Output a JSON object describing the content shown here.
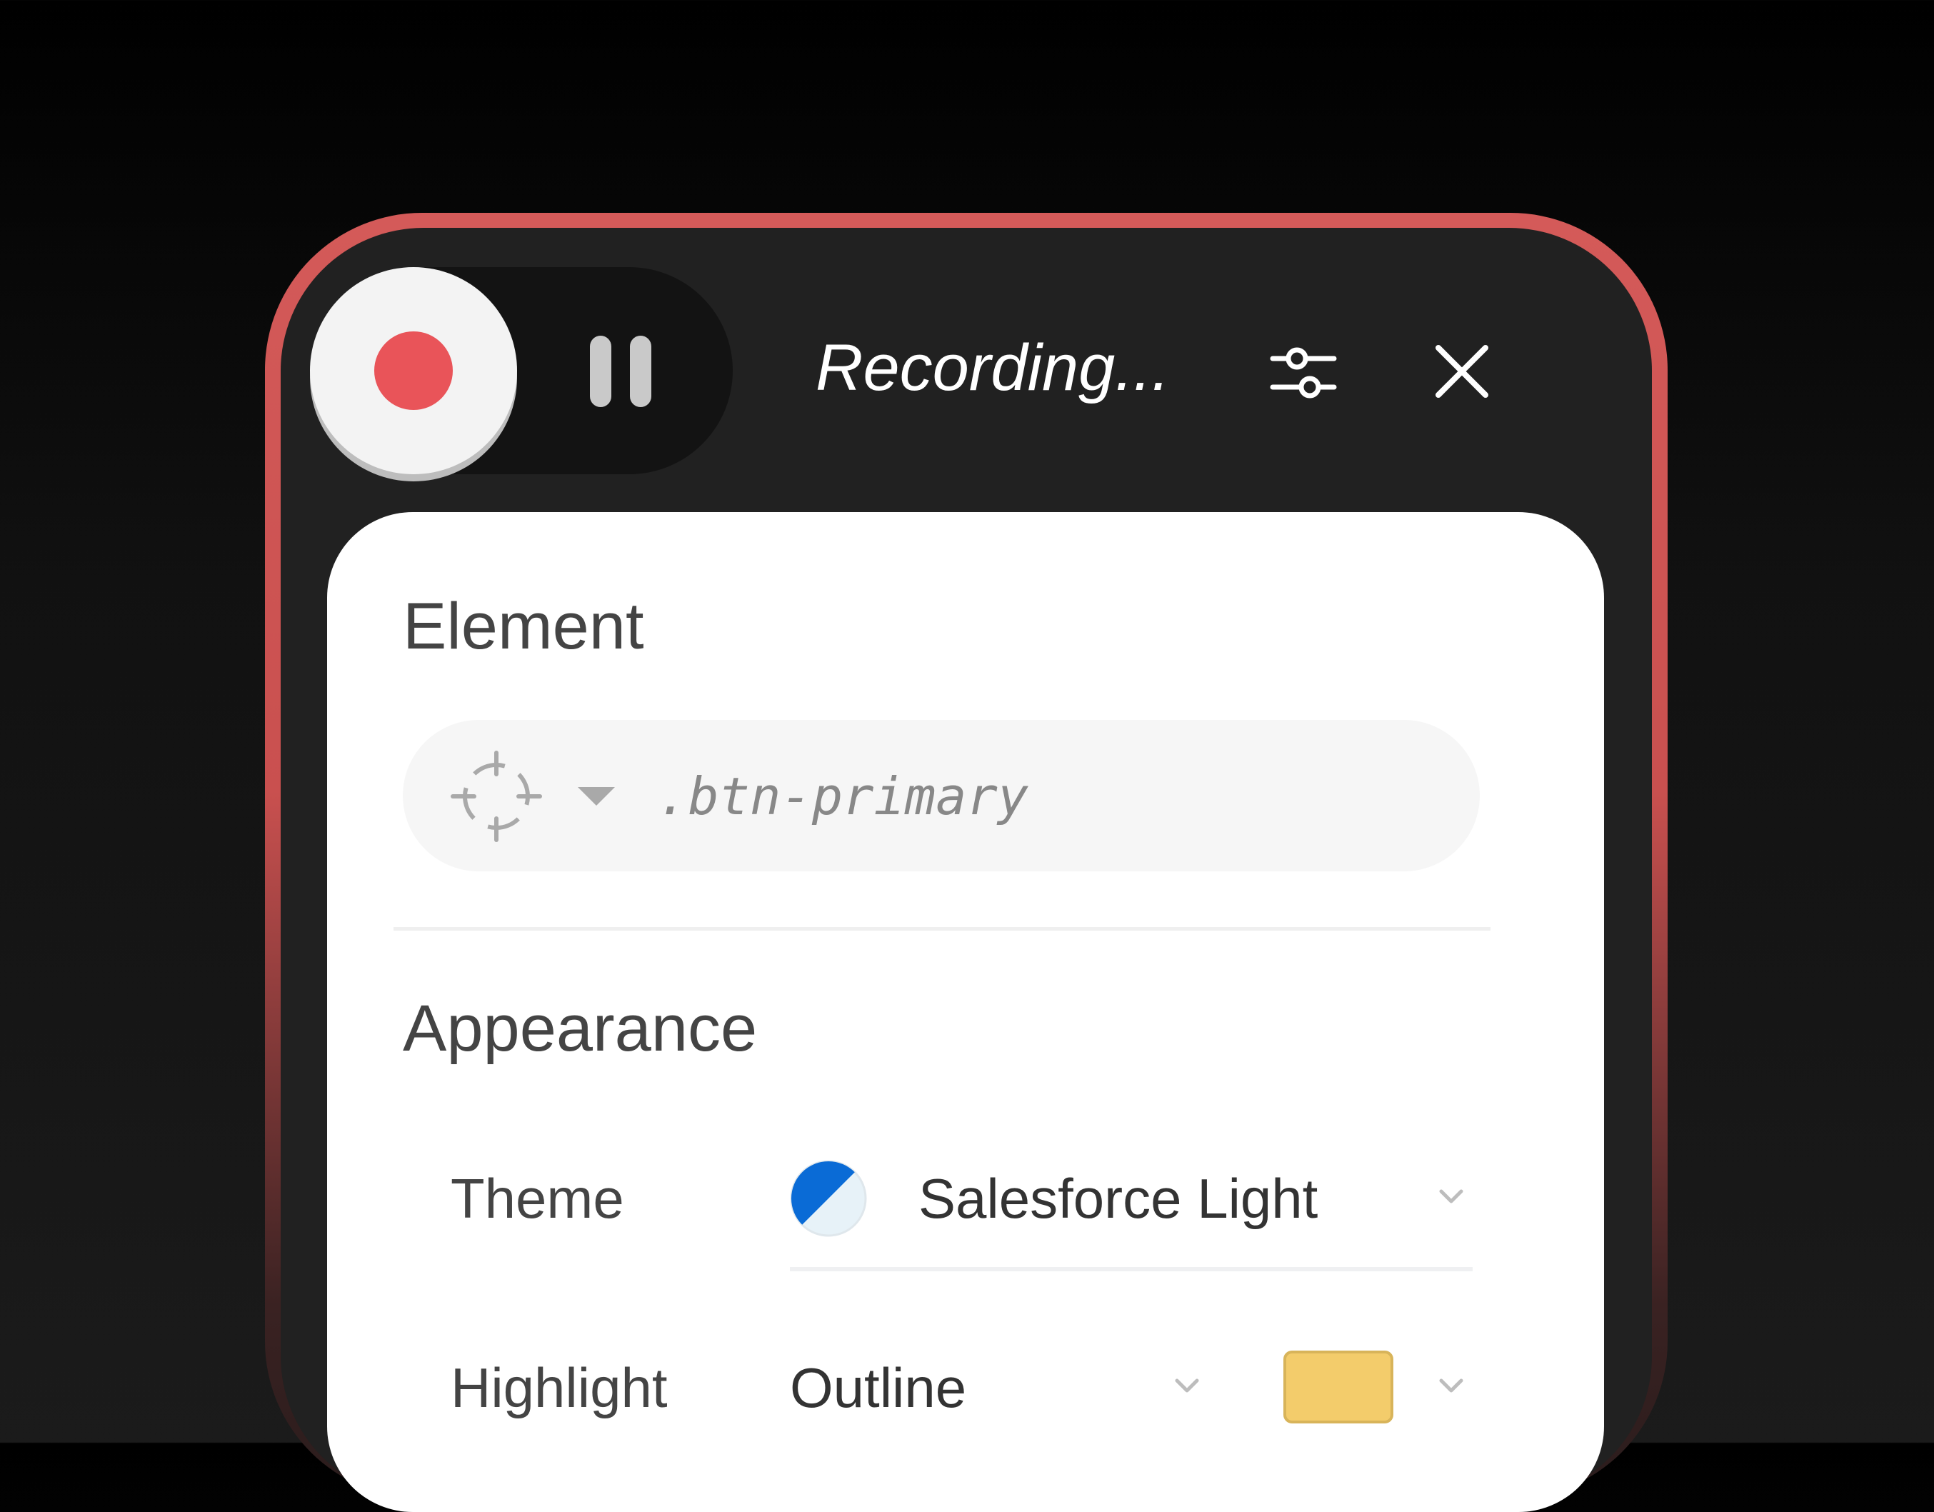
{
  "toolbar": {
    "status": "Recording...",
    "record_color": "#e95459",
    "icons": {
      "record": "record-icon",
      "pause": "pause-icon",
      "settings": "sliders-icon",
      "close": "close-icon"
    }
  },
  "element_section": {
    "title": "Element",
    "selector_value": ".btn-primary",
    "picker_icon": "crosshair-icon",
    "picker_dropdown_icon": "caret-down-icon"
  },
  "appearance_section": {
    "title": "Appearance",
    "theme": {
      "label": "Theme",
      "value": "Salesforce Light",
      "icon": "theme-swatch-icon",
      "icon_color": "#0a6bd6"
    },
    "highlight": {
      "label": "Highlight",
      "value": "Outline",
      "color": "#f3cc6b"
    }
  },
  "colors": {
    "frame_border": "#d45a59",
    "panel_background": "#212121",
    "card_background": "#ffffff"
  }
}
